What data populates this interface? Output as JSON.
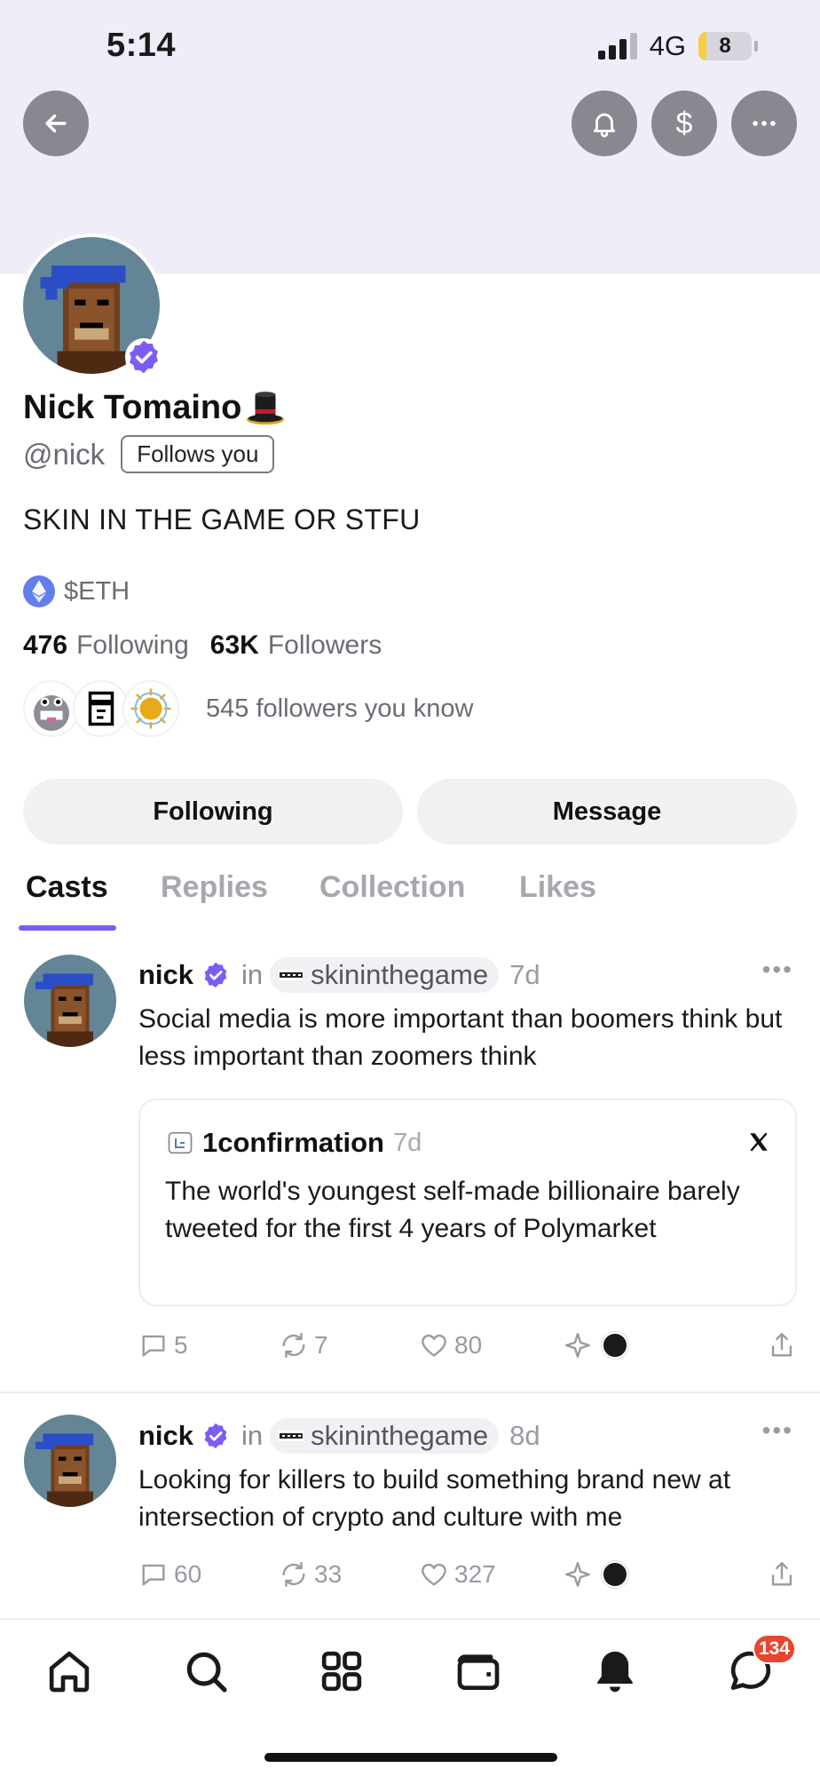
{
  "status_bar": {
    "time": "5:14",
    "network": "4G",
    "battery": "8",
    "battery_fraction": 0.08
  },
  "header": {
    "back_icon": "arrow-left-icon",
    "notify_icon": "bell-icon",
    "tip_symbol": "$",
    "more_icon": "ellipsis-icon"
  },
  "profile": {
    "display_name": "Nick Tomaino",
    "name_emoji": "top-hat-icon",
    "handle": "@nick",
    "follows_you": "Follows you",
    "bio": "SKIN IN THE GAME OR STFU",
    "token": "$ETH",
    "following_count": "476",
    "following_label": "Following",
    "followers_count": "63K",
    "followers_label": "Followers",
    "known_followers": "545 followers you know"
  },
  "actions": {
    "following_label": "Following",
    "message_label": "Message"
  },
  "tabs": [
    {
      "label": "Casts",
      "active": true
    },
    {
      "label": "Replies",
      "active": false
    },
    {
      "label": "Collection",
      "active": false
    },
    {
      "label": "Likes",
      "active": false
    }
  ],
  "casts": [
    {
      "author": "nick",
      "in_label": "in",
      "channel": "skininthegame",
      "age": "7d",
      "text": "Social media is more important than boomers think but less important than zoomers think",
      "embed": {
        "source": "1confirmation",
        "age": "7d",
        "platform_icon": "x-logo-icon",
        "text": "The world's youngest self-made billionaire barely tweeted for the first 4 years of Polymarket"
      },
      "replies": "5",
      "recasts": "7",
      "likes": "80"
    },
    {
      "author": "nick",
      "in_label": "in",
      "channel": "skininthegame",
      "age": "8d",
      "text": "Looking for killers to build something brand new at intersection of crypto and culture with me",
      "replies": "60",
      "recasts": "33",
      "likes": "327"
    }
  ],
  "bottom_nav": {
    "items": [
      "home-icon",
      "search-icon",
      "apps-grid-icon",
      "wallet-icon",
      "bell-icon",
      "chat-icon"
    ],
    "chat_badge": "134"
  },
  "colors": {
    "accent": "#7c5cf5",
    "banner": "#eeedf8",
    "badge": "#e8452e"
  }
}
